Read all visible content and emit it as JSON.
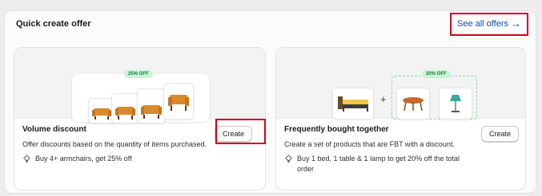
{
  "section": {
    "title": "Quick create offer",
    "see_all_label": "See all offers",
    "see_all_arrow": "→"
  },
  "cards": [
    {
      "badge": "25% OFF",
      "title": "Volume discount",
      "description": "Offer discounts based on the quantity of items purchased.",
      "tip": "Buy 4+ armchairs, get 25% off",
      "button": "Create"
    },
    {
      "badge": "20% OFF",
      "title": "Frequently bought together",
      "description": "Create a set of products that are FBT with a discount.",
      "tip": "Buy 1 bed, 1 table & 1 lamp to get 20% off the total order",
      "button": "Create"
    }
  ],
  "colors": {
    "highlight": "#d0021b",
    "link": "#1450a8",
    "badge_bg": "#c9f3d6",
    "badge_text": "#1f7a3b"
  },
  "icons": [
    "lightbulb-icon",
    "armchair-icon",
    "bed-icon",
    "table-icon",
    "lamp-icon",
    "arrow-right-icon",
    "plus-icon"
  ]
}
